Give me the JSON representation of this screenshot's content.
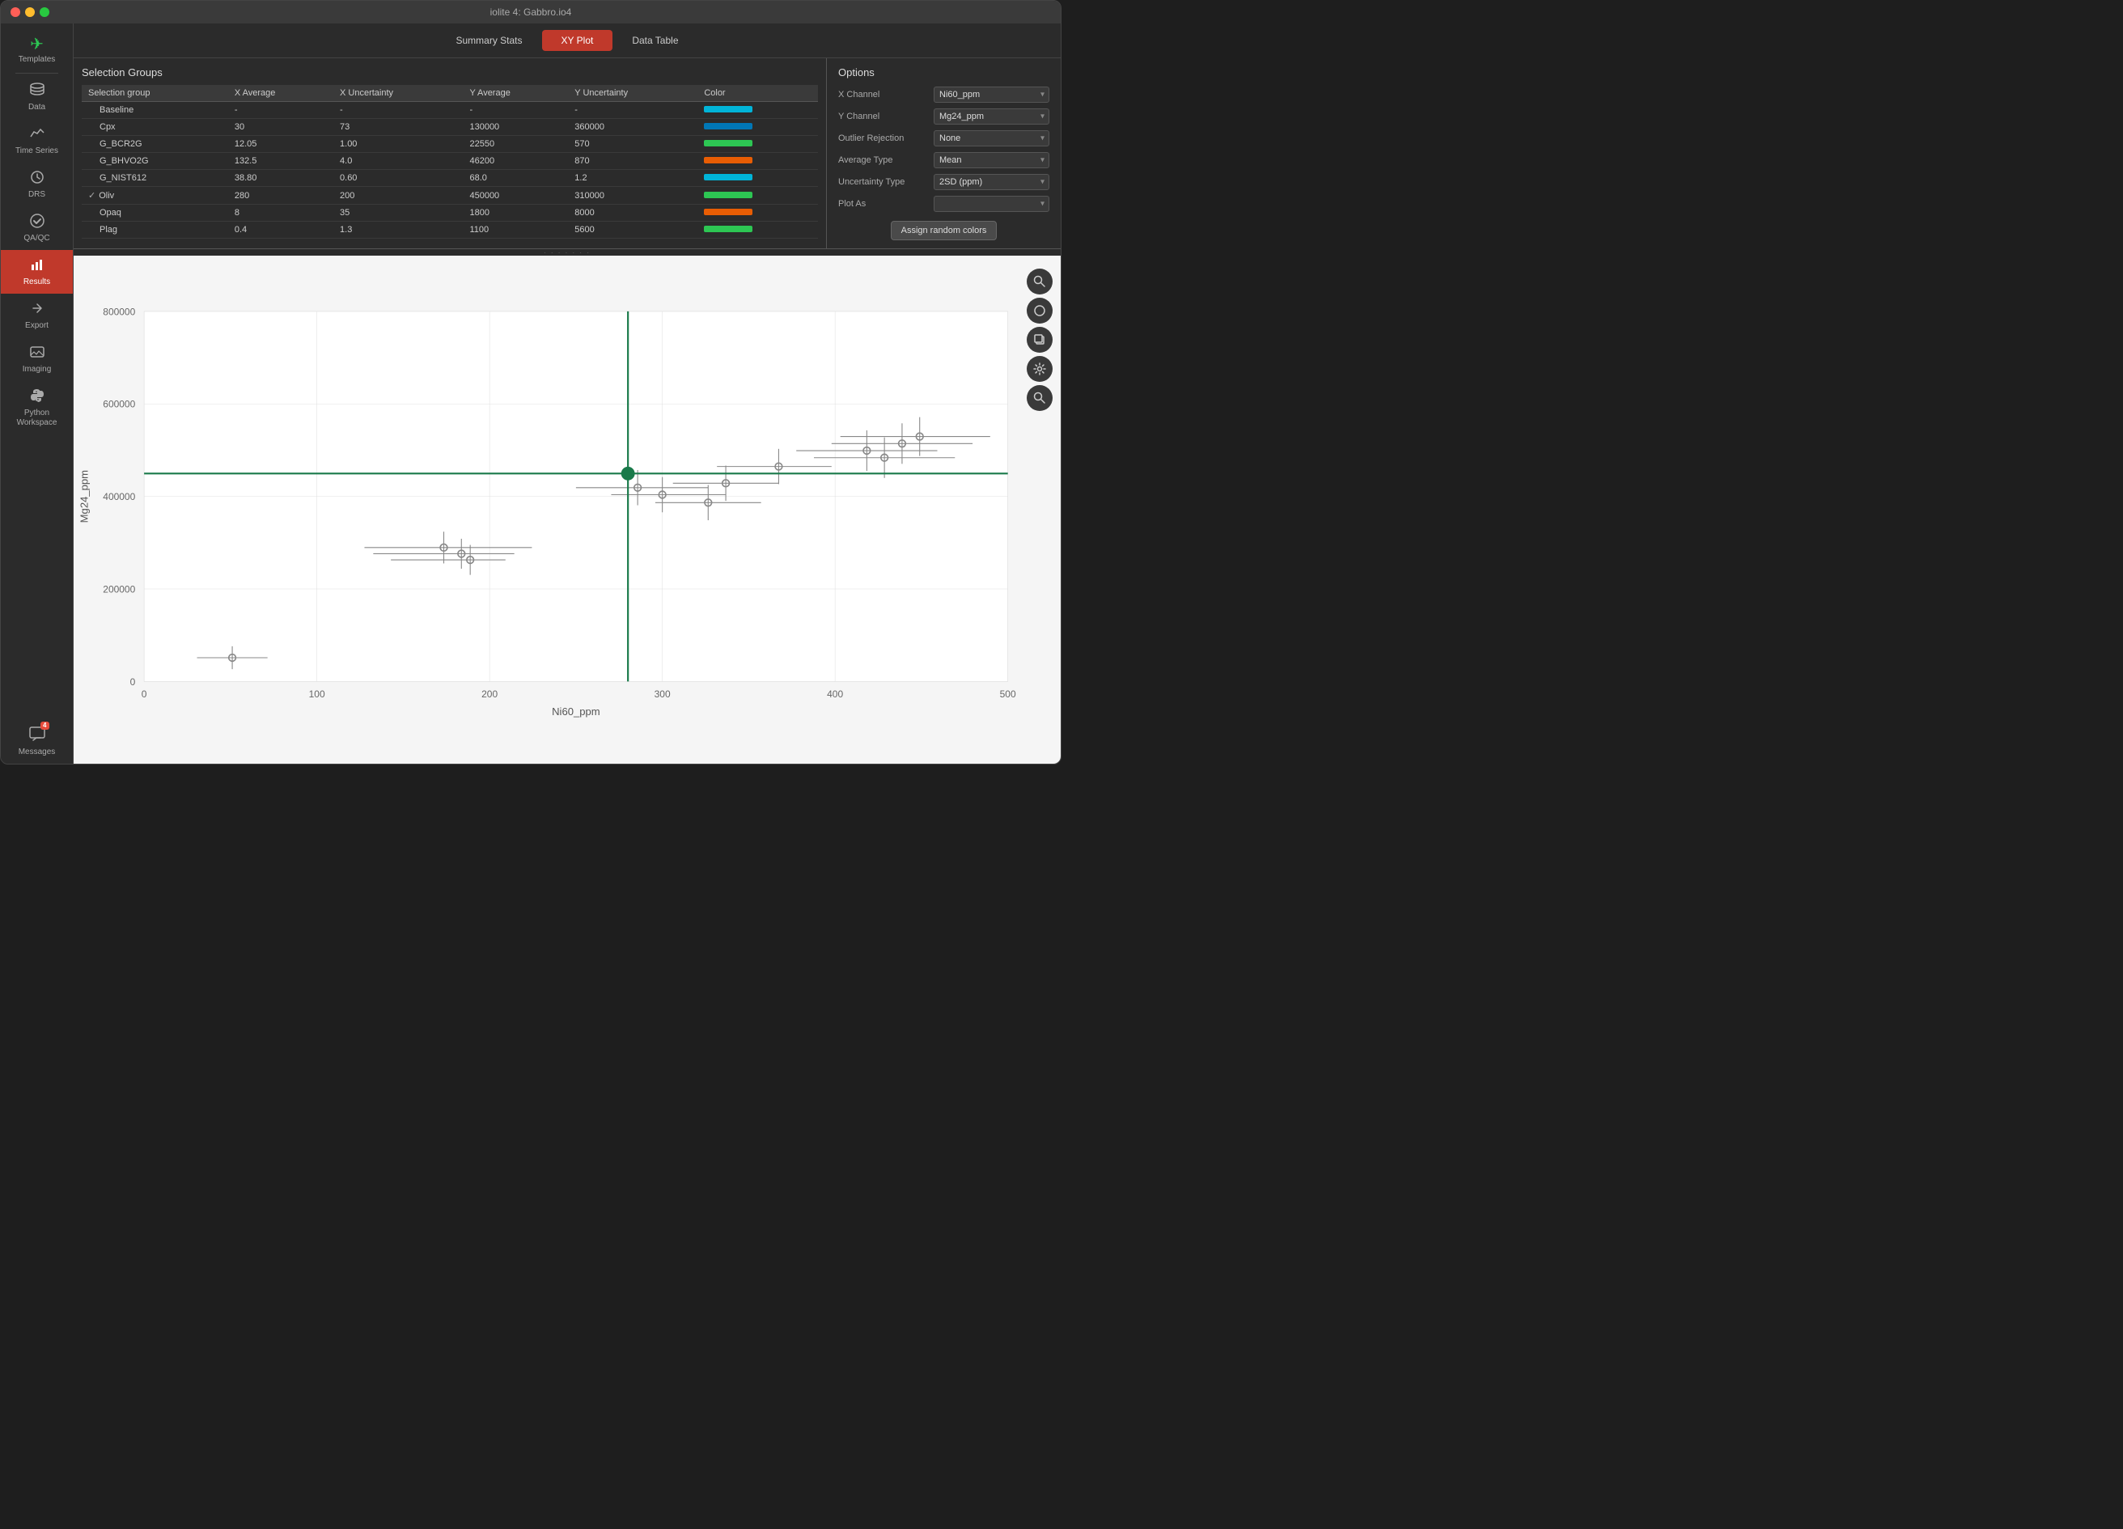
{
  "window": {
    "title": "iolite 4: Gabbro.io4"
  },
  "sidebar": {
    "items": [
      {
        "id": "templates",
        "label": "Templates",
        "icon": "✈",
        "active": false
      },
      {
        "id": "data",
        "label": "Data",
        "icon": "🗄",
        "active": false
      },
      {
        "id": "timeseries",
        "label": "Time Series",
        "icon": "📈",
        "active": false
      },
      {
        "id": "drs",
        "label": "DRS",
        "icon": "⚙",
        "active": false
      },
      {
        "id": "qaqc",
        "label": "QA/QC",
        "icon": "👍",
        "active": false
      },
      {
        "id": "results",
        "label": "Results",
        "icon": "📊",
        "active": true
      },
      {
        "id": "export",
        "label": "Export",
        "icon": "⇄",
        "active": false
      },
      {
        "id": "imaging",
        "label": "Imaging",
        "icon": "🗺",
        "active": false
      },
      {
        "id": "python",
        "label": "Python\nWorkspace",
        "icon": "🔱",
        "active": false
      },
      {
        "id": "messages",
        "label": "Messages",
        "icon": "💬",
        "active": false,
        "badge": "4"
      }
    ]
  },
  "tabs": [
    {
      "id": "summary",
      "label": "Summary Stats",
      "active": false
    },
    {
      "id": "xy",
      "label": "XY Plot",
      "active": true
    },
    {
      "id": "datatable",
      "label": "Data Table",
      "active": false
    }
  ],
  "selection_groups": {
    "title": "Selection Groups",
    "columns": [
      "Selection group",
      "X Average",
      "X Uncertainty",
      "Y Average",
      "Y Uncertainty",
      "Color"
    ],
    "rows": [
      {
        "name": "Baseline",
        "x_avg": "-",
        "x_unc": "-",
        "y_avg": "-",
        "y_unc": "-",
        "color": "#00b4d8",
        "checked": false
      },
      {
        "name": "Cpx",
        "x_avg": "30",
        "x_unc": "73",
        "y_avg": "130000",
        "y_unc": "360000",
        "color": "#0077b6",
        "checked": false
      },
      {
        "name": "G_BCR2G",
        "x_avg": "12.05",
        "x_unc": "1.00",
        "y_avg": "22550",
        "y_unc": "570",
        "color": "#2dc653",
        "checked": false
      },
      {
        "name": "G_BHVO2G",
        "x_avg": "132.5",
        "x_unc": "4.0",
        "y_avg": "46200",
        "y_unc": "870",
        "color": "#e85d04",
        "checked": false
      },
      {
        "name": "G_NIST612",
        "x_avg": "38.80",
        "x_unc": "0.60",
        "y_avg": "68.0",
        "y_unc": "1.2",
        "color": "#00b4d8",
        "checked": false
      },
      {
        "name": "Oliv",
        "x_avg": "280",
        "x_unc": "200",
        "y_avg": "450000",
        "y_unc": "310000",
        "color": "#2dc653",
        "checked": true
      },
      {
        "name": "Opaq",
        "x_avg": "8",
        "x_unc": "35",
        "y_avg": "1800",
        "y_unc": "8000",
        "color": "#e85d04",
        "checked": false
      },
      {
        "name": "Plag",
        "x_avg": "0.4",
        "x_unc": "1.3",
        "y_avg": "1100",
        "y_unc": "5600",
        "color": "#2dc653",
        "checked": false
      }
    ]
  },
  "options": {
    "title": "Options",
    "x_channel": {
      "label": "X Channel",
      "value": "Ni60_ppm"
    },
    "y_channel": {
      "label": "Y Channel",
      "value": "Mg24_ppm"
    },
    "outlier_rejection": {
      "label": "Outlier Rejection",
      "value": "None"
    },
    "average_type": {
      "label": "Average Type",
      "value": "Mean"
    },
    "uncertainty_type": {
      "label": "Uncertainty Type",
      "value": "2SD (ppm)"
    },
    "plot_as": {
      "label": "Plot As",
      "value": ""
    },
    "assign_button": "Assign random colors"
  },
  "chart": {
    "x_axis_label": "Ni60_ppm",
    "y_axis_label": "Mg24_ppm",
    "x_min": 0,
    "x_max": 500,
    "y_min": 0,
    "y_max": 800000,
    "x_ticks": [
      0,
      100,
      200,
      300,
      400,
      500
    ],
    "y_ticks": [
      0,
      200000,
      400000,
      600000,
      800000
    ]
  }
}
